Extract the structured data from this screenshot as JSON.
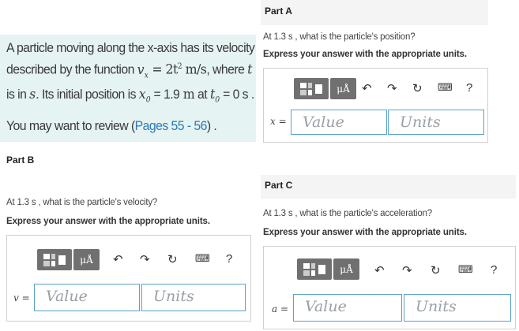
{
  "problem": {
    "line1": "A particle moving along the x-axis has its velocity",
    "line2_a": "described by the function",
    "line2_math": "v",
    "line2_sub": "x",
    "line2_b": " = 2t",
    "line2_sup": "2",
    "line2_unit": " m/s",
    "line2_c": ", where",
    "line2_t": "t",
    "line3_a": "is in",
    "line3_s": "s",
    "line3_b": ". Its initial position is",
    "line3_x0": "x",
    "line3_sub0": "0",
    "line3_c": " = 1.9",
    "line3_m": " m",
    "line3_d": " at",
    "line3_t0": "t",
    "line3_sub0b": "0",
    "line3_e": " = 0 s .",
    "review_a": "You may want to review (",
    "review_link": "Pages 55 - 56",
    "review_b": ") ."
  },
  "partA": {
    "title": "Part A",
    "question": "At 1.3 s , what is the particle's position?",
    "instruction": "Express your answer with the appropriate units.",
    "var": "x",
    "eq": " =",
    "value_placeholder": "Value",
    "units_placeholder": "Units",
    "units_btn": "μÅ",
    "help": "?"
  },
  "partB": {
    "title": "Part B",
    "question": "At 1.3 s , what is the particle's velocity?",
    "instruction": "Express your answer with the appropriate units.",
    "var": "v",
    "eq": " =",
    "value_placeholder": "Value",
    "units_placeholder": "Units",
    "units_btn": "μÅ",
    "help": "?"
  },
  "partC": {
    "title": "Part C",
    "question": "At 1.3 s , what is the particle's acceleration?",
    "instruction": "Express your answer with the appropriate units.",
    "var": "a",
    "eq": " =",
    "value_placeholder": "Value",
    "units_placeholder": "Units",
    "units_btn": "μÅ",
    "help": "?"
  },
  "icons": {
    "undo": "undo-icon",
    "redo": "redo-icon",
    "reset": "reset-icon",
    "keyboard": "keyboard-icon",
    "templates": "templates-icon"
  }
}
